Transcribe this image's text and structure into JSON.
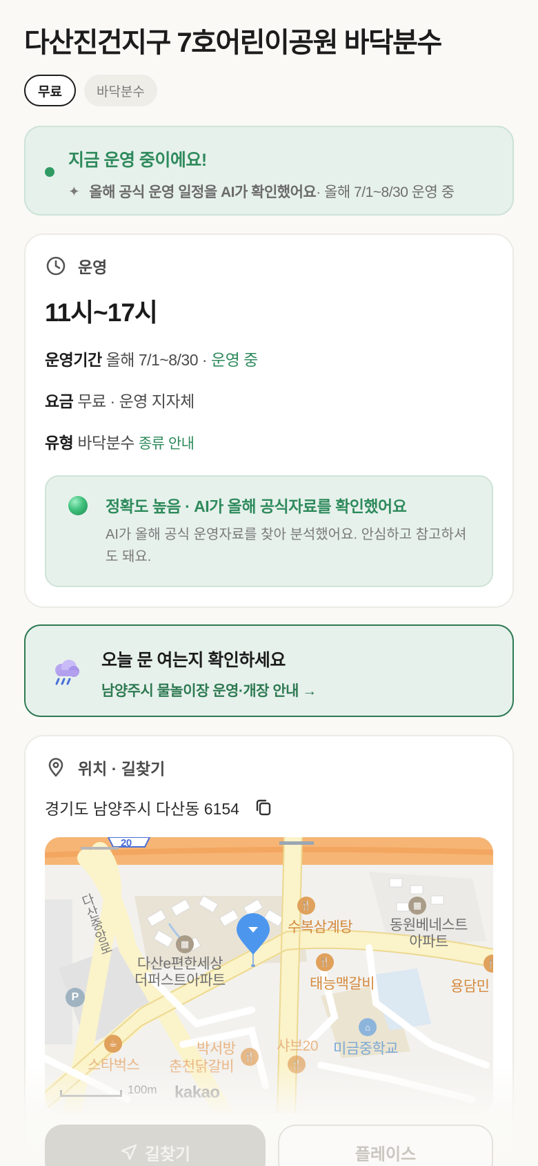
{
  "header": {
    "title": "다산진건지구 7호어린이공원 바닥분수",
    "chips": [
      "무료",
      "바닥분수"
    ]
  },
  "status": {
    "title": "지금 운영 중이에요!",
    "sub_bold": "올해 공식 운영 일정을 AI가 확인했어요",
    "sub_rest": " · 올해 7/1~8/30 운영 중"
  },
  "operation": {
    "heading": "운영",
    "hours": "11시~17시",
    "period_key": "운영기간",
    "period_value": "올해 7/1~8/30 · ",
    "period_status": "운영 중",
    "fee_key": "요금",
    "fee_value": "무료 · 운영 지자체",
    "type_key": "유형",
    "type_value": "바닥분수",
    "type_link": "종류 안내",
    "accuracy_title": "정확도 높음 · AI가 올해 공식자료를 확인했어요",
    "accuracy_desc": "AI가 올해 공식 운영자료를 찾아 분석했어요. 안심하고 참고하셔도 돼요."
  },
  "weather": {
    "title": "오늘 문 여는지 확인하세요",
    "link": "남양주시 물놀이장 운영·개장 안내 →"
  },
  "location": {
    "heading": "위치 · 길찾기",
    "address": "경기도 남양주시 다산동 6154",
    "map": {
      "road_badge": "20",
      "road_name": "다산중앙로",
      "places": {
        "subok": "수복삼계탕",
        "dongwon_1": "동원베네스트",
        "dongwon_2": "아파트",
        "dasan_1": "다산e편한세상",
        "dasan_2": "더퍼스트아파트",
        "taeneung": "태능맥갈비",
        "yongdam": "용담민",
        "parking": "P",
        "starbucks": "스타벅스",
        "parkseo": "박서방",
        "chuncheon": "춘천닭갈비",
        "shabu": "샤브20",
        "school": "미금중학교"
      },
      "scale_label": "100m",
      "attribution": "kakao"
    }
  },
  "actions": {
    "directions": "길찾기",
    "place": "플레이스"
  }
}
